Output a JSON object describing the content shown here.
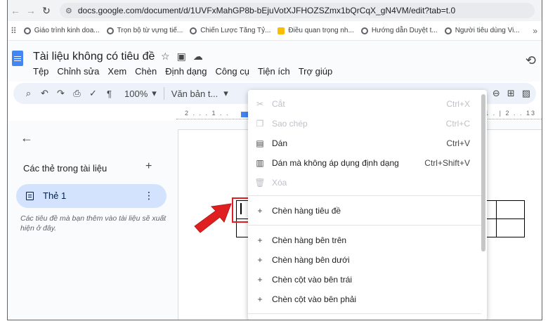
{
  "browser": {
    "url": "docs.google.com/document/d/1UVFxMahGP8b-bEjuVotXJFHOZSZmx1bQrCqX_gN4VM/edit?tab=t.0",
    "bookmarks": [
      "Giáo trình kinh doa...",
      "Trọn bộ từ vựng tiế...",
      "Chiến Lược Tăng Tỷ...",
      "Điều quan trọng nh...",
      "Hướng dẫn Duyệt t...",
      "Người tiêu dùng Vi..."
    ]
  },
  "doc": {
    "title": "Tài liệu không có tiêu đề",
    "menus": [
      "Tệp",
      "Chỉnh sửa",
      "Xem",
      "Chèn",
      "Định dạng",
      "Công cụ",
      "Tiện ích",
      "Trợ giúp"
    ]
  },
  "toolbar": {
    "zoom": "100%",
    "style": "Văn bản t...",
    "ruler_left": "2 . . . 1 . .",
    "ruler_right": "1 . | 2 . . 13"
  },
  "sidebar": {
    "section_title": "Các thẻ trong tài liệu",
    "tab_label": "Thẻ 1",
    "note": "Các tiêu đề mà bạn thêm vào tài liệu sẽ xuất hiện ở đây."
  },
  "context_menu": {
    "items": [
      {
        "label": "Cắt",
        "shortcut": "Ctrl+X",
        "icon": "scissors-icon"
      },
      {
        "label": "Sao chép",
        "shortcut": "Ctrl+C",
        "icon": "copy-icon"
      },
      {
        "label": "Dán",
        "shortcut": "Ctrl+V",
        "icon": "paste-icon"
      },
      {
        "label": "Dán mà không áp dụng định dạng",
        "shortcut": "Ctrl+Shift+V",
        "icon": "paste-plain-icon"
      },
      {
        "label": "Xóa",
        "shortcut": "",
        "icon": "trash-icon"
      },
      {
        "label": "Chèn hàng tiêu đề",
        "shortcut": "",
        "icon": "plus-icon"
      },
      {
        "label": "Chèn hàng bên trên",
        "shortcut": "",
        "icon": "plus-icon"
      },
      {
        "label": "Chèn hàng bên dưới",
        "shortcut": "",
        "icon": "plus-icon"
      },
      {
        "label": "Chèn cột vào bên trái",
        "shortcut": "",
        "icon": "plus-icon"
      },
      {
        "label": "Chèn cột vào bên phải",
        "shortcut": "",
        "icon": "plus-icon"
      }
    ]
  },
  "colors": {
    "accent": "#4285f4",
    "highlight_red": "#e02020",
    "tab_pill": "#d3e3fd"
  }
}
